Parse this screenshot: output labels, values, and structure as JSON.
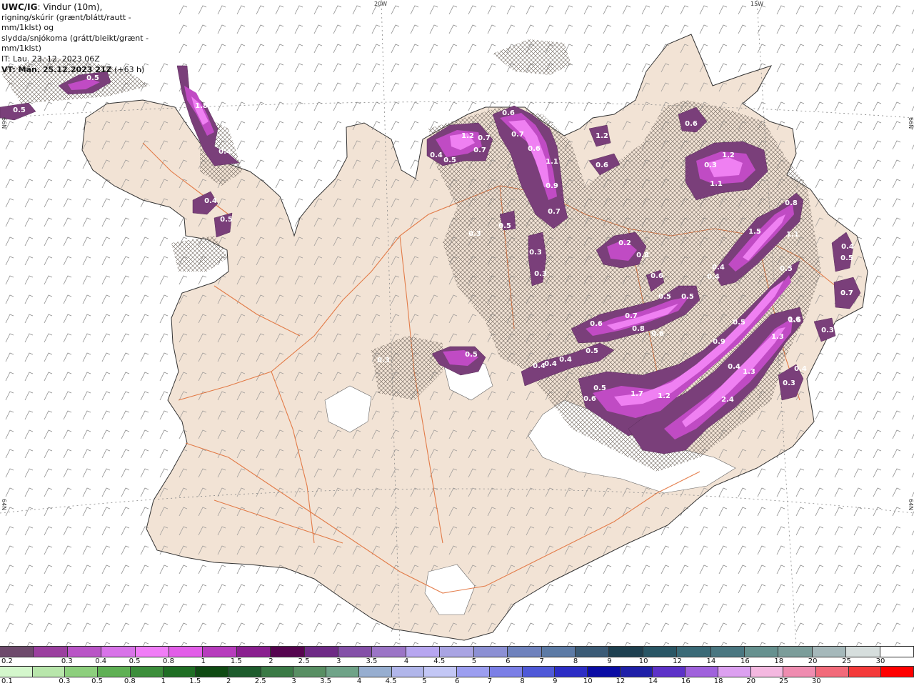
{
  "info": {
    "model": "UWC/IG",
    "line1": ": Vindur (10m),",
    "line2": "rigning/skúrir (grænt/blátt/rautt - mm/1klst) og",
    "line3": "slydda/snjókoma (grátt/bleikt/grænt - mm/1klst)",
    "it_line": "IT: Lau. 23. 12. 2023 06Z",
    "vt_label": "VT: Mán. 25.12.2023 21Z",
    "vt_offset": " (+63 h)"
  },
  "coords": {
    "w20": "20W",
    "w15": "15W",
    "n66_left": "66N",
    "n66_right": "66N",
    "n64_left": "64N",
    "n64_right": "64N"
  },
  "precip_labels": [
    "0.5",
    "0.5",
    "1.8",
    "0.4",
    "0.4",
    "0.5",
    "1.2",
    "0.7",
    "0.7",
    "0.4",
    "0.5",
    "0.6",
    "0.7",
    "0.6",
    "1.1",
    "0.9",
    "0.7",
    "0.5",
    "0.3",
    "0.3",
    "0.3",
    "1.2",
    "0.6",
    "0.6",
    "0.3",
    "1.2",
    "1.1",
    "0.8",
    "1.5",
    "1.1",
    "0.2",
    "0.8",
    "0.6",
    "0.4",
    "0.4",
    "0.4",
    "0.5",
    "0.5",
    "0.5",
    "0.4",
    "0.7",
    "0.8",
    "0.7",
    "0.6",
    "0.6",
    "0.5",
    "0.5",
    "0.4",
    "0.4",
    "0.3",
    "0.3",
    "0.9",
    "0.5",
    "0.5",
    "0.6",
    "0.5",
    "1.7",
    "1.2",
    "1.6",
    "1.3",
    "0.4",
    "1.3",
    "2.4",
    "0.4",
    "0.3",
    "0.3",
    "0.7",
    "0.6"
  ],
  "legend": {
    "snow": {
      "labels": [
        "0.2",
        "0.3",
        "0.4",
        "0.5",
        "0.8",
        "1",
        "1.5",
        "2",
        "2.5",
        "3",
        "3.5",
        "4",
        "4.5",
        "5",
        "6",
        "7",
        "8",
        "9",
        "10",
        "12",
        "14",
        "16",
        "18",
        "20",
        "25",
        "30"
      ],
      "colors": [
        "#6e4a6c",
        "#9b3f9f",
        "#b955c6",
        "#d873e8",
        "#f07df6",
        "#e25ee8",
        "#b73cbd",
        "#8a1f8f",
        "#55044f",
        "#6e2a86",
        "#8450a8",
        "#9b74c6",
        "#b7a6f0",
        "#a9a4e3",
        "#8c90d4",
        "#6f82bd",
        "#5c7aa5",
        "#3b5b76",
        "#1e4050",
        "#295665",
        "#3a6a77",
        "#4a7781",
        "#66918f",
        "#7b9d9a",
        "#a5b8ba",
        "#d6dedd",
        "#ffffff"
      ]
    },
    "rain": {
      "labels": [
        "0.1",
        "0.3",
        "0.5",
        "0.8",
        "1",
        "1.5",
        "2",
        "2.5",
        "3",
        "3.5",
        "4",
        "4.5",
        "5",
        "6",
        "7",
        "8",
        "9",
        "10",
        "12",
        "14",
        "16",
        "18",
        "20",
        "25",
        "30"
      ],
      "colors": [
        "#d4f7cc",
        "#b8e6ab",
        "#8dcf7d",
        "#5fb054",
        "#3c8e3b",
        "#1f6e24",
        "#0f4a13",
        "#1d5b2c",
        "#3a7a46",
        "#588f63",
        "#6fa388",
        "#97aed0",
        "#b1b6ea",
        "#c3c7f5",
        "#9c9ef0",
        "#7b7fe6",
        "#4f59d8",
        "#2c2dc5",
        "#0a0ca4",
        "#1f20a8",
        "#5d32c8",
        "#a062dc",
        "#dca0f0",
        "#f4b8e0",
        "#ef8cb0",
        "#f26a7a",
        "#f43a3a",
        "#ff0000"
      ]
    }
  }
}
